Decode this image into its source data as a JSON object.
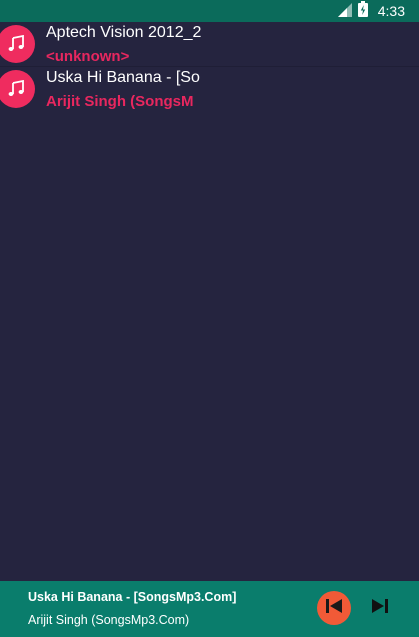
{
  "status_bar": {
    "time": "4:33",
    "icons": [
      "signal-icon",
      "battery-icon"
    ]
  },
  "songs": [
    {
      "title": "Aptech Vision 2012_2",
      "artist": "<unknown>",
      "icon": "music-note-icon"
    },
    {
      "title": "Uska Hi Banana - [So",
      "artist": "Arijit Singh (SongsM",
      "icon": "music-note-icon"
    }
  ],
  "now_playing": {
    "title": "Uska Hi Banana - [SongsMp3.Com]",
    "artist": "Arijit Singh (SongsMp3.Com)",
    "controls": [
      "previous-icon",
      "next-icon"
    ]
  },
  "colors": {
    "status_bar": "#0b6b5b",
    "background": "#25243f",
    "accent_pink": "#e8275f",
    "now_playing_bar": "#0a7d6c",
    "prev_button": "#f15a37"
  }
}
